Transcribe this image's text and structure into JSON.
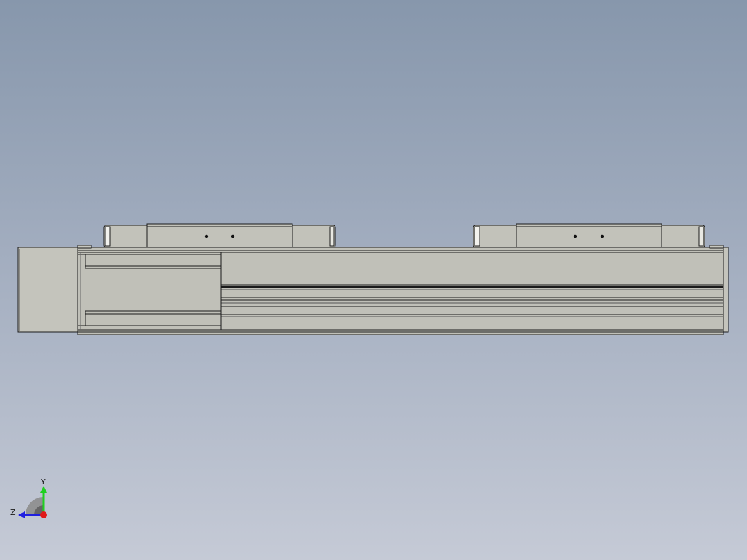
{
  "viewport": {
    "background_top": "#8797ac",
    "background_bottom": "#c5cad6",
    "model_face_color": "#c0c0b8",
    "model_edge_color": "#1a1a1a"
  },
  "triad": {
    "y_label": "Y",
    "z_label": "Z",
    "y_color": "#1fd01f",
    "z_color": "#1f1fe0",
    "x_color": "#e01a1a"
  }
}
